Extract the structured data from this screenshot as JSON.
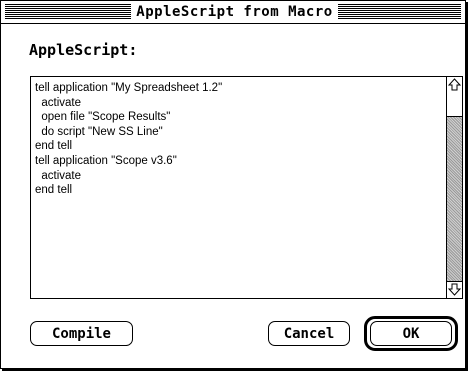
{
  "window": {
    "title": "AppleScript from Macro"
  },
  "dialog": {
    "label": "AppleScript:",
    "script_lines": [
      "tell application \"My Spreadsheet 1.2\"",
      "  activate",
      "  open file \"Scope Results\"",
      "  do script \"New SS Line\"",
      "end tell",
      "tell application \"Scope v3.6\"",
      "  activate",
      "end tell"
    ]
  },
  "buttons": {
    "compile": "Compile",
    "cancel": "Cancel",
    "ok": "OK"
  },
  "icons": {
    "scroll_up": "up-arrow-icon",
    "scroll_down": "down-arrow-icon"
  }
}
